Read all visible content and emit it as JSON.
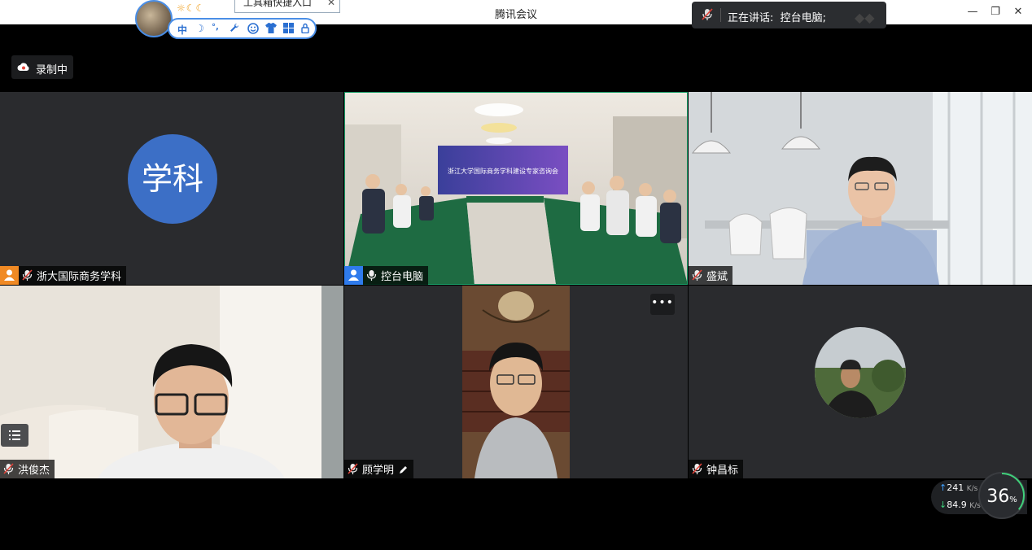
{
  "window": {
    "title": "腾讯会议",
    "minimize_icon": "minimize-icon",
    "restore_icon": "restore-icon",
    "close_icon": "close-icon"
  },
  "ime_toolbar": {
    "weather": "☼☾☾",
    "tip": "工具箱快捷入口",
    "items": [
      "中",
      "☽",
      "°,",
      "🔧",
      "☺",
      "👕",
      "▦",
      "🔒"
    ]
  },
  "speaking": {
    "label": "正在讲话:",
    "speaker": "控台电脑;"
  },
  "recording": {
    "label": "录制中"
  },
  "tiles": [
    {
      "name": "浙大国际商务学科",
      "avatar_text": "学科",
      "role_badge": "host"
    },
    {
      "name": "控台电脑",
      "role_badge": "cohost",
      "active": true
    },
    {
      "name": "盛斌"
    },
    {
      "name": "洪俊杰"
    },
    {
      "name": "顾学明"
    },
    {
      "name": "钟昌标"
    }
  ],
  "screen_banner": "浙江大学国际商务学科建设专家咨询会",
  "network": {
    "up": "241",
    "down": "84.9",
    "unit": "K/s",
    "cpu": "36",
    "cpu_unit": "%"
  },
  "colors": {
    "accent": "#2f7bec",
    "host": "#f08a24",
    "active_border": "#1a9e68"
  }
}
